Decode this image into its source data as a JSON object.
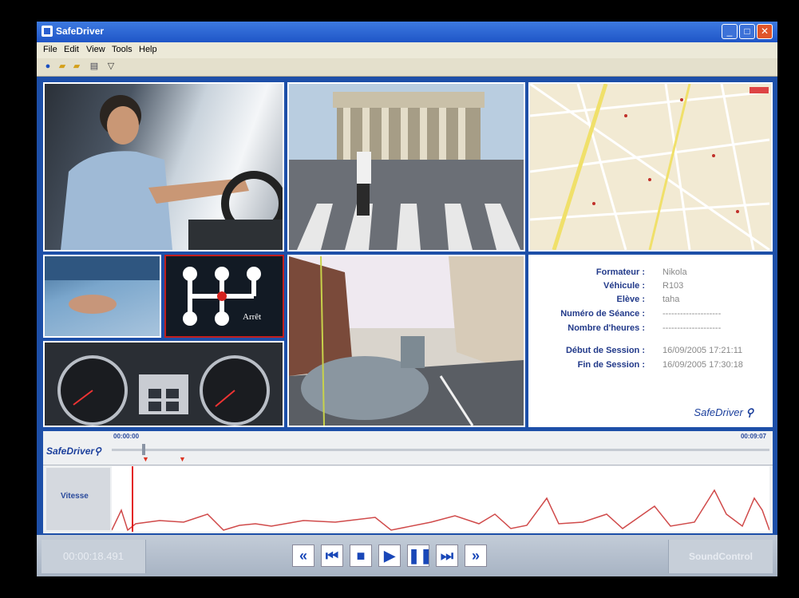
{
  "window": {
    "title": "SafeDriver"
  },
  "menu": [
    "File",
    "Edit",
    "View",
    "Tools",
    "Help"
  ],
  "gear": {
    "label": "Arrêt"
  },
  "info": {
    "rows": [
      {
        "label": "Formateur :",
        "value": "Nikola"
      },
      {
        "label": "Véhicule :",
        "value": "R103"
      },
      {
        "label": "Elève :",
        "value": "taha"
      },
      {
        "label": "Numéro de Séance :",
        "value": "--------------------"
      },
      {
        "label": "Nombre d'heures :",
        "value": "--------------------"
      },
      {
        "label": "Début de Session :",
        "value": "16/09/2005 17:21:11"
      },
      {
        "label": "Fin de Session :",
        "value": "16/09/2005 17:30:18"
      }
    ],
    "brand": "SafeDriver"
  },
  "timeline": {
    "brand": "SafeDriver",
    "start_time": "00:00:00",
    "end_time": "00:09:07",
    "graph_label": "Vitesse"
  },
  "controls": {
    "time": "00:00:18.491",
    "sound": "SoundControl"
  }
}
